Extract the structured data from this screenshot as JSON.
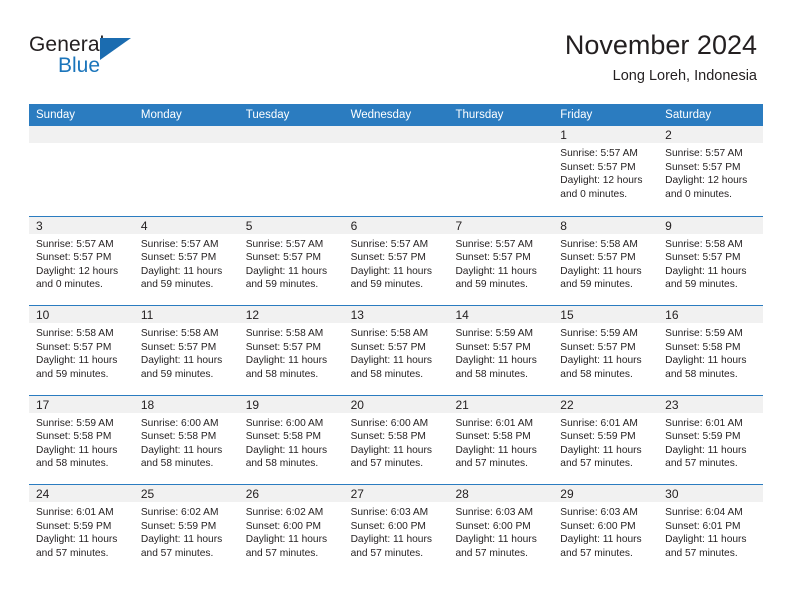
{
  "brand": {
    "name_part1": "General",
    "name_part2": "Blue",
    "accent_color": "#1b75bb",
    "triangle_color": "#1b6cb0"
  },
  "header": {
    "title": "November 2024",
    "subtitle": "Long Loreh, Indonesia"
  },
  "theme": {
    "header_bar_color": "#2b7cc0",
    "date_strip_color": "#f1f1f1",
    "text_color": "#231f20"
  },
  "calendar": {
    "day_headers": [
      "Sunday",
      "Monday",
      "Tuesday",
      "Wednesday",
      "Thursday",
      "Friday",
      "Saturday"
    ],
    "weeks": [
      [
        {
          "day": "",
          "lines": []
        },
        {
          "day": "",
          "lines": []
        },
        {
          "day": "",
          "lines": []
        },
        {
          "day": "",
          "lines": []
        },
        {
          "day": "",
          "lines": []
        },
        {
          "day": "1",
          "lines": [
            "Sunrise: 5:57 AM",
            "Sunset: 5:57 PM",
            "Daylight: 12 hours",
            "and 0 minutes."
          ]
        },
        {
          "day": "2",
          "lines": [
            "Sunrise: 5:57 AM",
            "Sunset: 5:57 PM",
            "Daylight: 12 hours",
            "and 0 minutes."
          ]
        }
      ],
      [
        {
          "day": "3",
          "lines": [
            "Sunrise: 5:57 AM",
            "Sunset: 5:57 PM",
            "Daylight: 12 hours",
            "and 0 minutes."
          ]
        },
        {
          "day": "4",
          "lines": [
            "Sunrise: 5:57 AM",
            "Sunset: 5:57 PM",
            "Daylight: 11 hours",
            "and 59 minutes."
          ]
        },
        {
          "day": "5",
          "lines": [
            "Sunrise: 5:57 AM",
            "Sunset: 5:57 PM",
            "Daylight: 11 hours",
            "and 59 minutes."
          ]
        },
        {
          "day": "6",
          "lines": [
            "Sunrise: 5:57 AM",
            "Sunset: 5:57 PM",
            "Daylight: 11 hours",
            "and 59 minutes."
          ]
        },
        {
          "day": "7",
          "lines": [
            "Sunrise: 5:57 AM",
            "Sunset: 5:57 PM",
            "Daylight: 11 hours",
            "and 59 minutes."
          ]
        },
        {
          "day": "8",
          "lines": [
            "Sunrise: 5:58 AM",
            "Sunset: 5:57 PM",
            "Daylight: 11 hours",
            "and 59 minutes."
          ]
        },
        {
          "day": "9",
          "lines": [
            "Sunrise: 5:58 AM",
            "Sunset: 5:57 PM",
            "Daylight: 11 hours",
            "and 59 minutes."
          ]
        }
      ],
      [
        {
          "day": "10",
          "lines": [
            "Sunrise: 5:58 AM",
            "Sunset: 5:57 PM",
            "Daylight: 11 hours",
            "and 59 minutes."
          ]
        },
        {
          "day": "11",
          "lines": [
            "Sunrise: 5:58 AM",
            "Sunset: 5:57 PM",
            "Daylight: 11 hours",
            "and 59 minutes."
          ]
        },
        {
          "day": "12",
          "lines": [
            "Sunrise: 5:58 AM",
            "Sunset: 5:57 PM",
            "Daylight: 11 hours",
            "and 58 minutes."
          ]
        },
        {
          "day": "13",
          "lines": [
            "Sunrise: 5:58 AM",
            "Sunset: 5:57 PM",
            "Daylight: 11 hours",
            "and 58 minutes."
          ]
        },
        {
          "day": "14",
          "lines": [
            "Sunrise: 5:59 AM",
            "Sunset: 5:57 PM",
            "Daylight: 11 hours",
            "and 58 minutes."
          ]
        },
        {
          "day": "15",
          "lines": [
            "Sunrise: 5:59 AM",
            "Sunset: 5:57 PM",
            "Daylight: 11 hours",
            "and 58 minutes."
          ]
        },
        {
          "day": "16",
          "lines": [
            "Sunrise: 5:59 AM",
            "Sunset: 5:58 PM",
            "Daylight: 11 hours",
            "and 58 minutes."
          ]
        }
      ],
      [
        {
          "day": "17",
          "lines": [
            "Sunrise: 5:59 AM",
            "Sunset: 5:58 PM",
            "Daylight: 11 hours",
            "and 58 minutes."
          ]
        },
        {
          "day": "18",
          "lines": [
            "Sunrise: 6:00 AM",
            "Sunset: 5:58 PM",
            "Daylight: 11 hours",
            "and 58 minutes."
          ]
        },
        {
          "day": "19",
          "lines": [
            "Sunrise: 6:00 AM",
            "Sunset: 5:58 PM",
            "Daylight: 11 hours",
            "and 58 minutes."
          ]
        },
        {
          "day": "20",
          "lines": [
            "Sunrise: 6:00 AM",
            "Sunset: 5:58 PM",
            "Daylight: 11 hours",
            "and 57 minutes."
          ]
        },
        {
          "day": "21",
          "lines": [
            "Sunrise: 6:01 AM",
            "Sunset: 5:58 PM",
            "Daylight: 11 hours",
            "and 57 minutes."
          ]
        },
        {
          "day": "22",
          "lines": [
            "Sunrise: 6:01 AM",
            "Sunset: 5:59 PM",
            "Daylight: 11 hours",
            "and 57 minutes."
          ]
        },
        {
          "day": "23",
          "lines": [
            "Sunrise: 6:01 AM",
            "Sunset: 5:59 PM",
            "Daylight: 11 hours",
            "and 57 minutes."
          ]
        }
      ],
      [
        {
          "day": "24",
          "lines": [
            "Sunrise: 6:01 AM",
            "Sunset: 5:59 PM",
            "Daylight: 11 hours",
            "and 57 minutes."
          ]
        },
        {
          "day": "25",
          "lines": [
            "Sunrise: 6:02 AM",
            "Sunset: 5:59 PM",
            "Daylight: 11 hours",
            "and 57 minutes."
          ]
        },
        {
          "day": "26",
          "lines": [
            "Sunrise: 6:02 AM",
            "Sunset: 6:00 PM",
            "Daylight: 11 hours",
            "and 57 minutes."
          ]
        },
        {
          "day": "27",
          "lines": [
            "Sunrise: 6:03 AM",
            "Sunset: 6:00 PM",
            "Daylight: 11 hours",
            "and 57 minutes."
          ]
        },
        {
          "day": "28",
          "lines": [
            "Sunrise: 6:03 AM",
            "Sunset: 6:00 PM",
            "Daylight: 11 hours",
            "and 57 minutes."
          ]
        },
        {
          "day": "29",
          "lines": [
            "Sunrise: 6:03 AM",
            "Sunset: 6:00 PM",
            "Daylight: 11 hours",
            "and 57 minutes."
          ]
        },
        {
          "day": "30",
          "lines": [
            "Sunrise: 6:04 AM",
            "Sunset: 6:01 PM",
            "Daylight: 11 hours",
            "and 57 minutes."
          ]
        }
      ]
    ]
  }
}
